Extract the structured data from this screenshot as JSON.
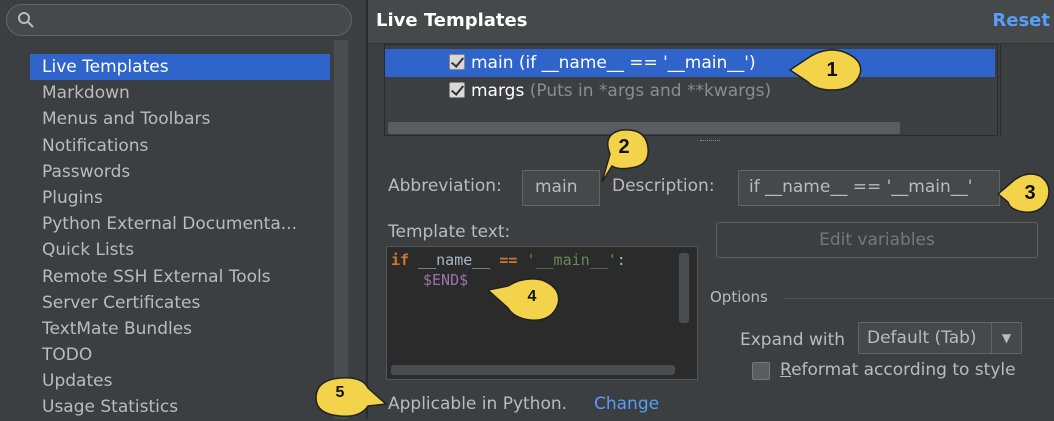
{
  "search": {
    "placeholder": ""
  },
  "sidebar": {
    "items": [
      {
        "label": "Live Templates",
        "selected": true
      },
      {
        "label": "Markdown"
      },
      {
        "label": "Menus and Toolbars"
      },
      {
        "label": "Notifications"
      },
      {
        "label": "Passwords"
      },
      {
        "label": "Plugins"
      },
      {
        "label": "Python External Documenta..."
      },
      {
        "label": "Quick Lists"
      },
      {
        "label": "Remote SSH External Tools"
      },
      {
        "label": "Server Certificates"
      },
      {
        "label": "TextMate Bundles"
      },
      {
        "label": "TODO"
      },
      {
        "label": "Updates"
      },
      {
        "label": "Usage Statistics"
      }
    ]
  },
  "header": {
    "title": "Live Templates",
    "reset_label": "Reset"
  },
  "templates": {
    "rows": [
      {
        "name": "main (if __name__ == '__main__')",
        "desc": "",
        "checked": true,
        "selected": true
      },
      {
        "name": "margs",
        "desc": " (Puts in *args and **kwargs)",
        "checked": true,
        "selected": false
      }
    ]
  },
  "form": {
    "abbreviation_label": "Abbreviation:",
    "abbreviation_value": "main",
    "description_label": "Description:",
    "description_value": "if __name__ == '__main__'",
    "template_text_label": "Template text:",
    "code": {
      "line1_kw": "if",
      "line1_mid": " __name__ ",
      "line1_op": "==",
      "line1_str": " '__main__'",
      "line1_end": ":",
      "line2": "$END$"
    },
    "edit_variables_label": "Edit variables",
    "options_label": "Options",
    "expand_with_label": "Expand with",
    "expand_with_value": "Default (Tab)",
    "reformat_label_u": "R",
    "reformat_label_rest": "eformat according to style",
    "reformat_checked": false,
    "applicable_label": "Applicable in Python.",
    "change_label": "Change"
  },
  "callouts": [
    "1",
    "2",
    "3",
    "4",
    "5"
  ],
  "colors": {
    "selection": "#2f65ca",
    "link": "#589df6",
    "callout_fill": "#f3d34a"
  }
}
